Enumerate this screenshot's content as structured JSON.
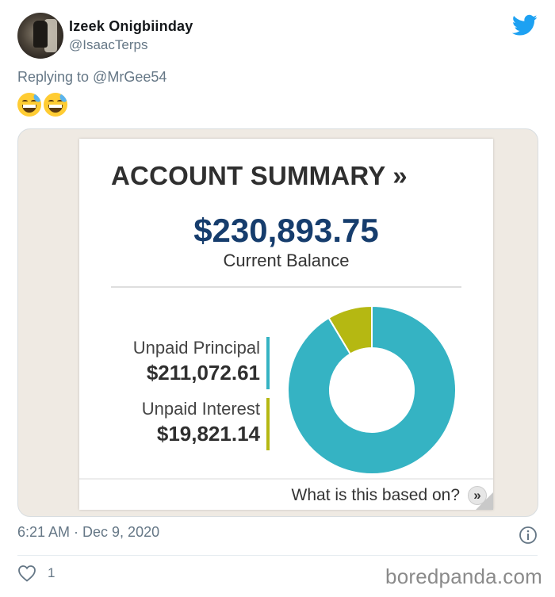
{
  "tweet": {
    "author_name": "Izeek Onigbiinday",
    "author_handle": "@IsaacTerps",
    "replying_to": "Replying to @MrGee54",
    "emojis": [
      "grinning-face-with-sweat",
      "grinning-face-with-sweat"
    ],
    "timestamp": "6:21 AM · Dec 9, 2020",
    "like_count": "1"
  },
  "account_summary": {
    "title": "ACCOUNT SUMMARY »",
    "balance": "$230,893.75",
    "balance_label": "Current Balance",
    "principal_label": "Unpaid Principal",
    "principal_value": "$211,072.61",
    "interest_label": "Unpaid Interest",
    "interest_value": "$19,821.14",
    "footer_link": "What is this based on?",
    "footer_button": "»"
  },
  "chart_data": {
    "type": "pie",
    "donut": true,
    "categories": [
      "Unpaid Principal",
      "Unpaid Interest"
    ],
    "values": [
      211072.61,
      19821.14
    ],
    "colors": [
      "#35b3c3",
      "#b5b812"
    ]
  },
  "colors": {
    "twitter_blue": "#1da1f2",
    "balance_navy": "#163d6d",
    "muted_text": "#657786"
  },
  "watermark": "boredpanda.com"
}
